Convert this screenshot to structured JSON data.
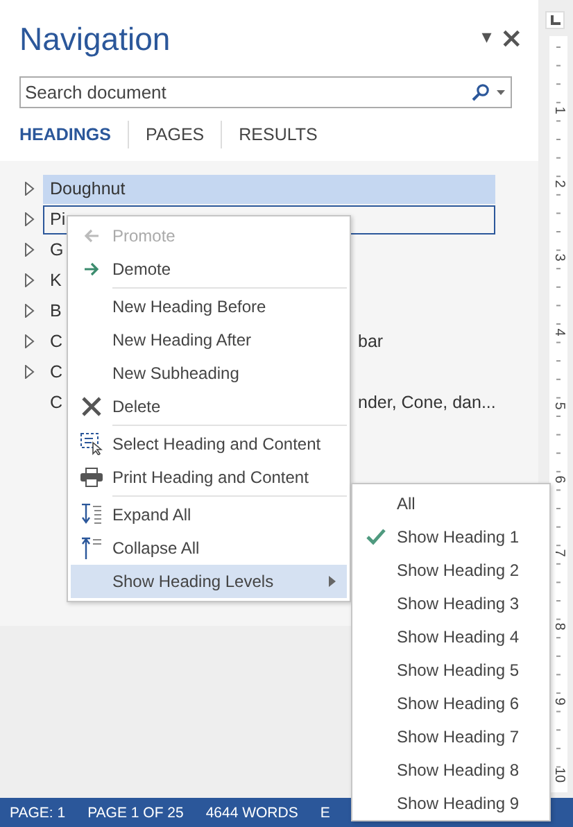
{
  "pane": {
    "title": "Navigation",
    "options_glyph": "▾",
    "close_glyph": "×"
  },
  "search": {
    "placeholder": "Search document"
  },
  "tabs": [
    {
      "label": "HEADINGS",
      "selected": true
    },
    {
      "label": "PAGES",
      "selected": false
    },
    {
      "label": "RESULTS",
      "selected": false
    }
  ],
  "headings": [
    {
      "text": "Doughnut",
      "collapsible": true,
      "selected": true,
      "focused": false
    },
    {
      "text": "Pi",
      "collapsible": true,
      "selected": false,
      "focused": true
    },
    {
      "text": "G",
      "collapsible": true,
      "selected": false,
      "focused": false
    },
    {
      "text": "K",
      "collapsible": true,
      "selected": false,
      "focused": false
    },
    {
      "text": "B",
      "collapsible": true,
      "selected": false,
      "focused": false
    },
    {
      "text": "C",
      "tail": "bar",
      "collapsible": true,
      "selected": false,
      "focused": false
    },
    {
      "text": "C",
      "collapsible": true,
      "selected": false,
      "focused": false
    },
    {
      "text": "C",
      "tail": "nder, Cone, dan...",
      "collapsible": false,
      "selected": false,
      "focused": false
    }
  ],
  "context_menu": [
    {
      "label": "Promote",
      "kind": "promote",
      "disabled": true,
      "highlighted": false
    },
    {
      "label": "Demote",
      "kind": "demote",
      "disabled": false,
      "highlighted": false
    },
    {
      "label": "New Heading Before",
      "kind": "plain",
      "separator_before": true,
      "disabled": false,
      "highlighted": false
    },
    {
      "label": "New Heading After",
      "kind": "plain",
      "disabled": false,
      "highlighted": false
    },
    {
      "label": "New Subheading",
      "kind": "plain",
      "disabled": false,
      "highlighted": false
    },
    {
      "label": "Delete",
      "kind": "delete",
      "disabled": false,
      "highlighted": false
    },
    {
      "label": "Select Heading and Content",
      "kind": "select",
      "separator_before": true,
      "disabled": false,
      "highlighted": false
    },
    {
      "label": "Print Heading and Content",
      "kind": "print",
      "disabled": false,
      "highlighted": false
    },
    {
      "label": "Expand All",
      "kind": "expand",
      "separator_before": true,
      "disabled": false,
      "highlighted": false
    },
    {
      "label": "Collapse All",
      "kind": "collapse",
      "disabled": false,
      "highlighted": false
    },
    {
      "label": "Show Heading Levels",
      "kind": "plain",
      "submenu": true,
      "disabled": false,
      "highlighted": true
    }
  ],
  "submenu": [
    {
      "label": "All",
      "checked": false
    },
    {
      "label": "Show Heading 1",
      "checked": true
    },
    {
      "label": "Show Heading 2",
      "checked": false
    },
    {
      "label": "Show Heading 3",
      "checked": false
    },
    {
      "label": "Show Heading 4",
      "checked": false
    },
    {
      "label": "Show Heading 5",
      "checked": false
    },
    {
      "label": "Show Heading 6",
      "checked": false
    },
    {
      "label": "Show Heading 7",
      "checked": false
    },
    {
      "label": "Show Heading 8",
      "checked": false
    },
    {
      "label": "Show Heading 9",
      "checked": false
    }
  ],
  "ruler_numbers": [
    "1",
    "2",
    "3",
    "4",
    "5",
    "6",
    "7",
    "8",
    "9",
    "10"
  ],
  "status_bar": [
    "PAGE: 1",
    "PAGE 1 OF 25",
    "4644 WORDS",
    "E"
  ]
}
